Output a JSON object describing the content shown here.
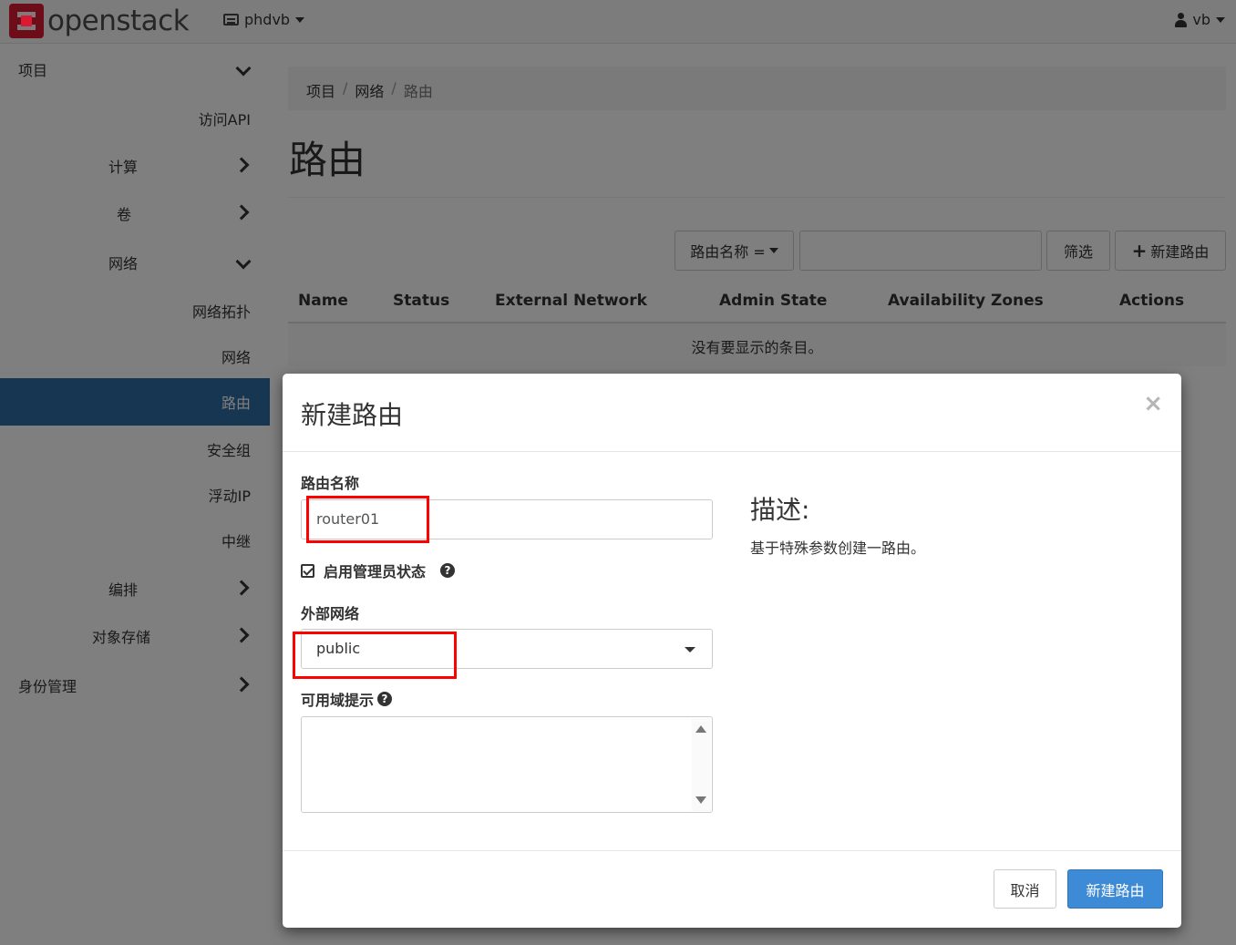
{
  "topbar": {
    "brand": "openstack",
    "project": "phdvb",
    "user": "vb"
  },
  "sidebar": {
    "items": [
      {
        "label": "项目",
        "chevron": "down"
      },
      {
        "label": "访问API"
      },
      {
        "label": "计算",
        "chevron": "right"
      },
      {
        "label": "卷",
        "chevron": "right"
      },
      {
        "label": "网络",
        "chevron": "down"
      },
      {
        "label": "网络拓扑"
      },
      {
        "label": "网络"
      },
      {
        "label": "路由",
        "active": true
      },
      {
        "label": "安全组"
      },
      {
        "label": "浮动IP"
      },
      {
        "label": "中继"
      },
      {
        "label": "编排",
        "chevron": "right"
      },
      {
        "label": "对象存储",
        "chevron": "right"
      },
      {
        "label": "身份管理",
        "chevron": "right"
      }
    ]
  },
  "breadcrumb": [
    "项目",
    "网络",
    "路由"
  ],
  "page_title": "路由",
  "toolbar": {
    "filter_field": "路由名称 =",
    "filter_value": "",
    "filter_button": "筛选",
    "create_button": "新建路由"
  },
  "table": {
    "columns": [
      "Name",
      "Status",
      "External Network",
      "Admin State",
      "Availability Zones",
      "Actions"
    ],
    "empty_message": "没有要显示的条目。"
  },
  "modal": {
    "title": "新建路由",
    "close": "×",
    "name_label": "路由名称",
    "name_value": "router01",
    "admin_state_label": "启用管理员状态",
    "admin_state_checked": true,
    "external_network_label": "外部网络",
    "external_network_value": "public",
    "az_hint_label": "可用域提示",
    "description_title": "描述:",
    "description_text": "基于特殊参数创建一路由。",
    "cancel_button": "取消",
    "submit_button": "新建路由"
  },
  "colors": {
    "brand": "#da1a32",
    "active_nav": "#2d6ca2",
    "primary_button": "#3d8ad7",
    "highlight": "#ff0000"
  }
}
